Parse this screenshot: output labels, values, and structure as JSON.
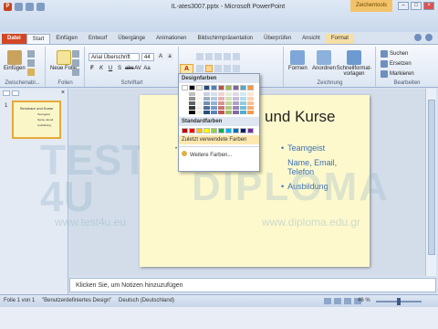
{
  "window": {
    "title": "IL-ates3007.pptx - Microsoft PowerPoint",
    "context_tab_title": "Zeichentools",
    "app_badge": "P"
  },
  "tabs": [
    "Datei",
    "Start",
    "Einfügen",
    "Entwurf",
    "Übergänge",
    "Animationen",
    "Bildschirmpräsentation",
    "Überprüfen",
    "Ansicht",
    "Format"
  ],
  "ribbon": {
    "clipboard": {
      "label": "Zwischenabl...",
      "paste": "Einfügen"
    },
    "slides": {
      "label": "Folien",
      "new_slide": "Neue Folie"
    },
    "font": {
      "label": "Schriftart",
      "font_name": "Arial Überschrift",
      "font_size": "44"
    },
    "drawing": {
      "label": "Zeichnung",
      "shapes": "Formen",
      "arrange": "Anordnen",
      "quick_styles": "Schnellformat-vorlagen"
    },
    "editing": {
      "label": "Bearbeiten",
      "find": "Suchen",
      "replace": "Ersetzen",
      "select": "Markieren"
    }
  },
  "color_popup": {
    "design_colors_label": "Designfarben",
    "standard_colors_label": "Standardfarben",
    "recent_label": "Zuletzt verwendete Farben",
    "more_colors": "Weitere Farben...",
    "theme_row": [
      "#ffffff",
      "#000000",
      "#eeece1",
      "#1f497d",
      "#4f81bd",
      "#c0504d",
      "#9bbb59",
      "#8064a2",
      "#4bacc6",
      "#f79646"
    ],
    "standard_row": [
      "#c00000",
      "#ff0000",
      "#ffc000",
      "#ffff00",
      "#92d050",
      "#00b050",
      "#00b0f0",
      "#0070c0",
      "#002060",
      "#7030a0"
    ]
  },
  "slide": {
    "title": "und Kurse",
    "bullets": [
      "Teamgeist",
      "Name, Email, Telefon",
      "Ausbildung"
    ]
  },
  "thumbnail": {
    "number": "1",
    "title": "Seminare und Kurse",
    "lines": [
      "Teamgeist",
      "Name, Email",
      "Ausbildung"
    ]
  },
  "notes_placeholder": "Klicken Sie, um Notizen hinzuzufügen",
  "status": {
    "slide_info": "Folie 1 von 1",
    "theme": "\"Benutzerdefiniertes Design\"",
    "language": "Deutsch (Deutschland)",
    "zoom": "46 %"
  },
  "watermark": {
    "line1": "TEST",
    "line2": "4U",
    "brand": "DIPLOMA",
    "url1": "www.test4u.eu",
    "url2": "www.diploma.edu.gr"
  }
}
